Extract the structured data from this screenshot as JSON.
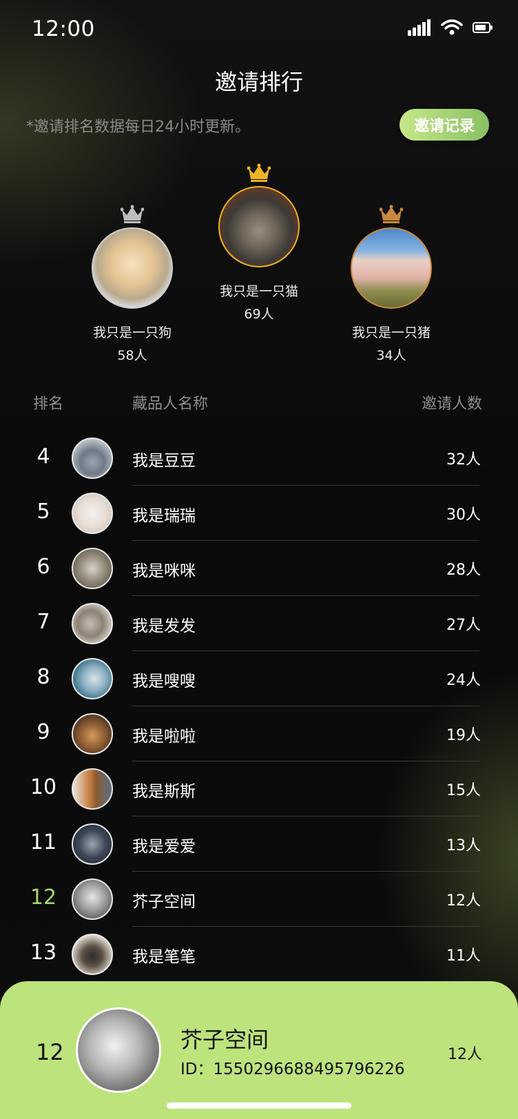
{
  "status": {
    "time": "12:00"
  },
  "header": {
    "title": "邀请排行",
    "note": "*邀请排名数据每日24小时更新。",
    "record_button": "邀请记录"
  },
  "podium": [
    {
      "name": "我只是一只狗",
      "count": "58人",
      "crown": "silver-crown-icon"
    },
    {
      "name": "我只是一只猫",
      "count": "69人",
      "crown": "gold-crown-icon"
    },
    {
      "name": "我只是一只猪",
      "count": "34人",
      "crown": "bronze-crown-icon"
    }
  ],
  "table_header": {
    "rank": "排名",
    "name": "藏品人名称",
    "count": "邀请人数"
  },
  "rows": [
    {
      "rank": "4",
      "name": "我是豆豆",
      "count": "32人"
    },
    {
      "rank": "5",
      "name": "我是瑞瑞",
      "count": "30人"
    },
    {
      "rank": "6",
      "name": "我是咪咪",
      "count": "28人"
    },
    {
      "rank": "7",
      "name": "我是发发",
      "count": "27人"
    },
    {
      "rank": "8",
      "name": "我是嗖嗖",
      "count": "24人"
    },
    {
      "rank": "9",
      "name": "我是啦啦",
      "count": "19人"
    },
    {
      "rank": "10",
      "name": "我是斯斯",
      "count": "15人"
    },
    {
      "rank": "11",
      "name": "我是爱爱",
      "count": "13人"
    },
    {
      "rank": "12",
      "name": "芥子空间",
      "count": "12人"
    },
    {
      "rank": "13",
      "name": "我是笔笔",
      "count": "11人"
    }
  ],
  "me": {
    "rank": "12",
    "name": "芥子空间",
    "id": "ID：1550296688495796226",
    "count": "12人"
  },
  "colors": {
    "accent": "#bde37c",
    "highlight_rank": "#a9d66a",
    "gold": "#f0b323",
    "silver": "#bdbdbd",
    "bronze": "#c98a3e"
  }
}
